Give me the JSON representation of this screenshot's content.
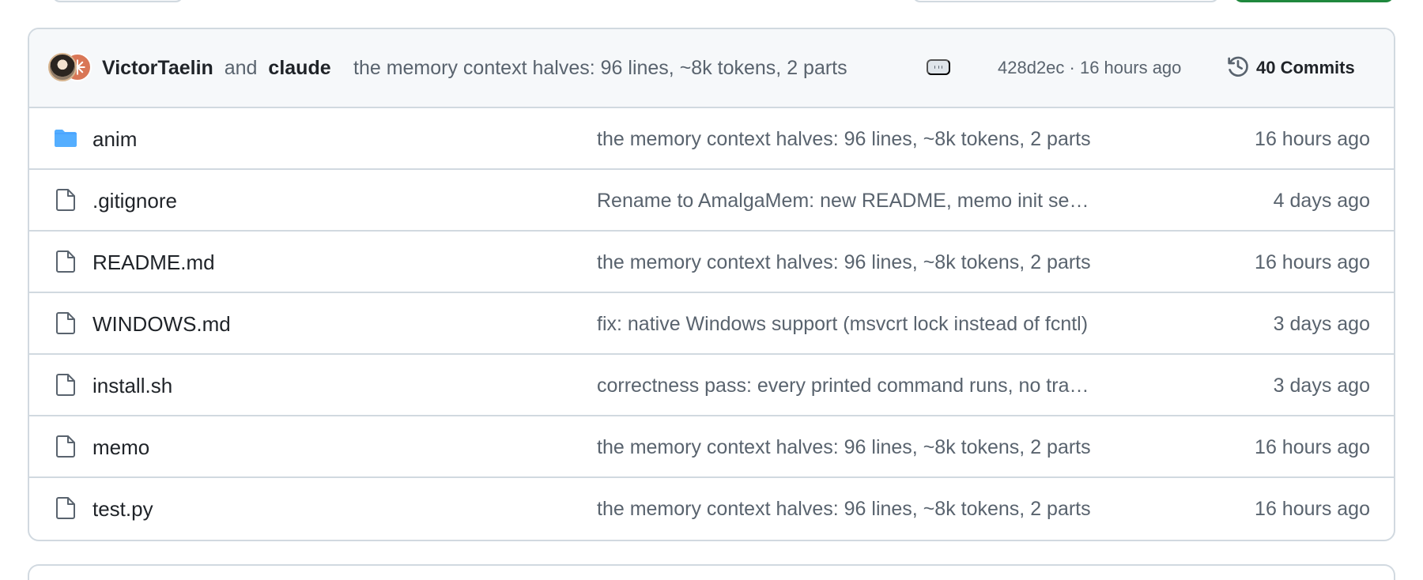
{
  "theme": {
    "accent_green": "#1f883d",
    "folder_blue": "#54aeff",
    "border": "#d1d9e0",
    "muted_text": "#59636e",
    "primary_text": "#1f2328",
    "header_background": "#f6f8fa"
  },
  "latest_commit": {
    "authors": [
      "VictorTaelin",
      "claude"
    ],
    "author_1": "VictorTaelin",
    "joiner": "and",
    "author_2": "claude",
    "message": "the memory context halves: 96 lines, ~8k tokens, 2 parts",
    "meta": "428d2ec · 16 hours ago",
    "commits_label": "40 Commits",
    "icons": {
      "avatar_1": "victor-avatar",
      "avatar_2": "claude-avatar",
      "ellipsis": "ellipsis-icon",
      "history": "history-icon"
    }
  },
  "files": [
    {
      "type": "folder",
      "icon": "folder-icon",
      "name": "anim",
      "message": "the memory context halves: 96 lines, ~8k tokens, 2 parts",
      "time": "16 hours ago"
    },
    {
      "type": "file",
      "icon": "file-icon",
      "name": ".gitignore",
      "message": "Rename to AmalgaMem: new README, memo init setup, e...",
      "time": "4 days ago"
    },
    {
      "type": "file",
      "icon": "file-icon",
      "name": "README.md",
      "message": "the memory context halves: 96 lines, ~8k tokens, 2 parts",
      "time": "16 hours ago"
    },
    {
      "type": "file",
      "icon": "file-icon",
      "name": "WINDOWS.md",
      "message": "fix: native Windows support (msvcrt lock instead of fcntl)",
      "time": "3 days ago"
    },
    {
      "type": "file",
      "icon": "file-icon",
      "name": "install.sh",
      "message": "correctness pass: every printed command runs, no traceb...",
      "time": "3 days ago"
    },
    {
      "type": "file",
      "icon": "file-icon",
      "name": "memo",
      "message": "the memory context halves: 96 lines, ~8k tokens, 2 parts",
      "time": "16 hours ago"
    },
    {
      "type": "file",
      "icon": "file-icon",
      "name": "test.py",
      "message": "the memory context halves: 96 lines, ~8k tokens, 2 parts",
      "time": "16 hours ago"
    }
  ]
}
